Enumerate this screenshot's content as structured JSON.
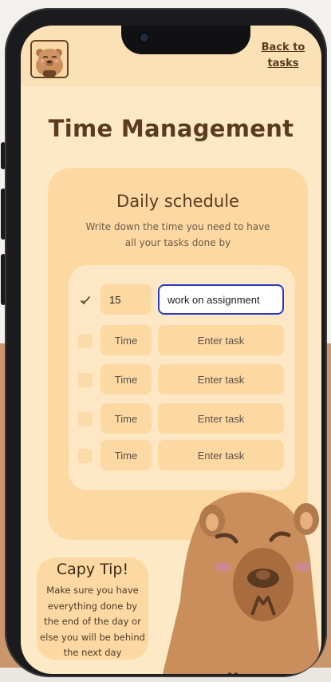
{
  "header": {
    "back_link": "Back to tasks",
    "avatar_icon": "capybara-avatar-icon"
  },
  "page": {
    "title": "Time Management"
  },
  "schedule": {
    "heading": "Daily schedule",
    "subtitle": "Write down the time you need to have all your tasks done by",
    "rows": [
      {
        "checked": true,
        "time": "15",
        "task": "work on assignment",
        "time_placeholder": "Time",
        "task_placeholder": "Enter task"
      },
      {
        "checked": false,
        "time": "",
        "task": "",
        "time_placeholder": "Time",
        "task_placeholder": "Enter task"
      },
      {
        "checked": false,
        "time": "",
        "task": "",
        "time_placeholder": "Time",
        "task_placeholder": "Enter task"
      },
      {
        "checked": false,
        "time": "",
        "task": "",
        "time_placeholder": "Time",
        "task_placeholder": "Enter task"
      },
      {
        "checked": false,
        "time": "",
        "task": "",
        "time_placeholder": "Time",
        "task_placeholder": "Enter task"
      }
    ]
  },
  "tip": {
    "title": "Capy Tip!",
    "body": "Make sure you have everything done by the end of the day or else you will be behind the next day"
  },
  "colors": {
    "screen_bg": "#fde9c5",
    "card_bg": "#fcd9a2",
    "title_brown": "#5b3a22",
    "focus_border": "#2b3bbf",
    "capybara": "#c98e5c"
  }
}
